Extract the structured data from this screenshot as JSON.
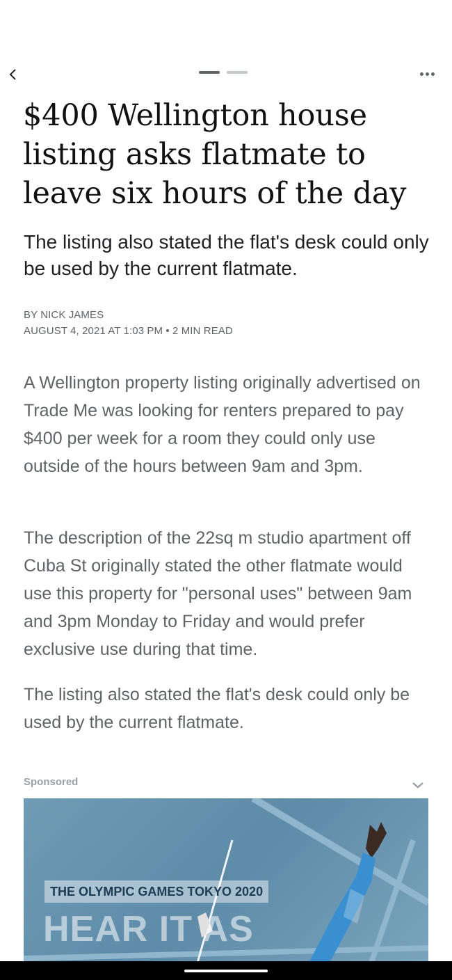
{
  "header": {
    "back_icon": "chevron-left-icon",
    "more_icon": "more-horizontal-icon"
  },
  "article": {
    "headline": "$400 Wellington house listing asks flatmate to leave six hours of the day",
    "dek": "The listing also stated the flat's desk could only be used by the current flatmate.",
    "byline": "BY NICK JAMES",
    "dateline": "AUGUST 4, 2021 AT 1:03 PM • 2 MIN READ",
    "paragraphs": [
      "A Wellington property listing originally advertised on Trade Me was looking for renters prepared to pay $400 per week for a room they could only use outside of the hours between 9am and 3pm.",
      "The description of the 22sq m studio apartment off Cuba St originally stated the other flatmate would use this property for \"personal uses\" between 9am and 3pm Monday to Friday and would prefer exclusive use during that time.",
      "The listing also stated the flat's desk could only be used by the current flatmate."
    ]
  },
  "sponsored": {
    "label": "Sponsored",
    "ad_tag": "THE OLYMPIC GAMES TOKYO 2020",
    "ad_headline": "HEAR IT AS"
  },
  "colors": {
    "text_primary": "#202124",
    "text_secondary": "#5f6368",
    "ad_background": "#6f9bb5",
    "nav_bar": "#000000"
  }
}
